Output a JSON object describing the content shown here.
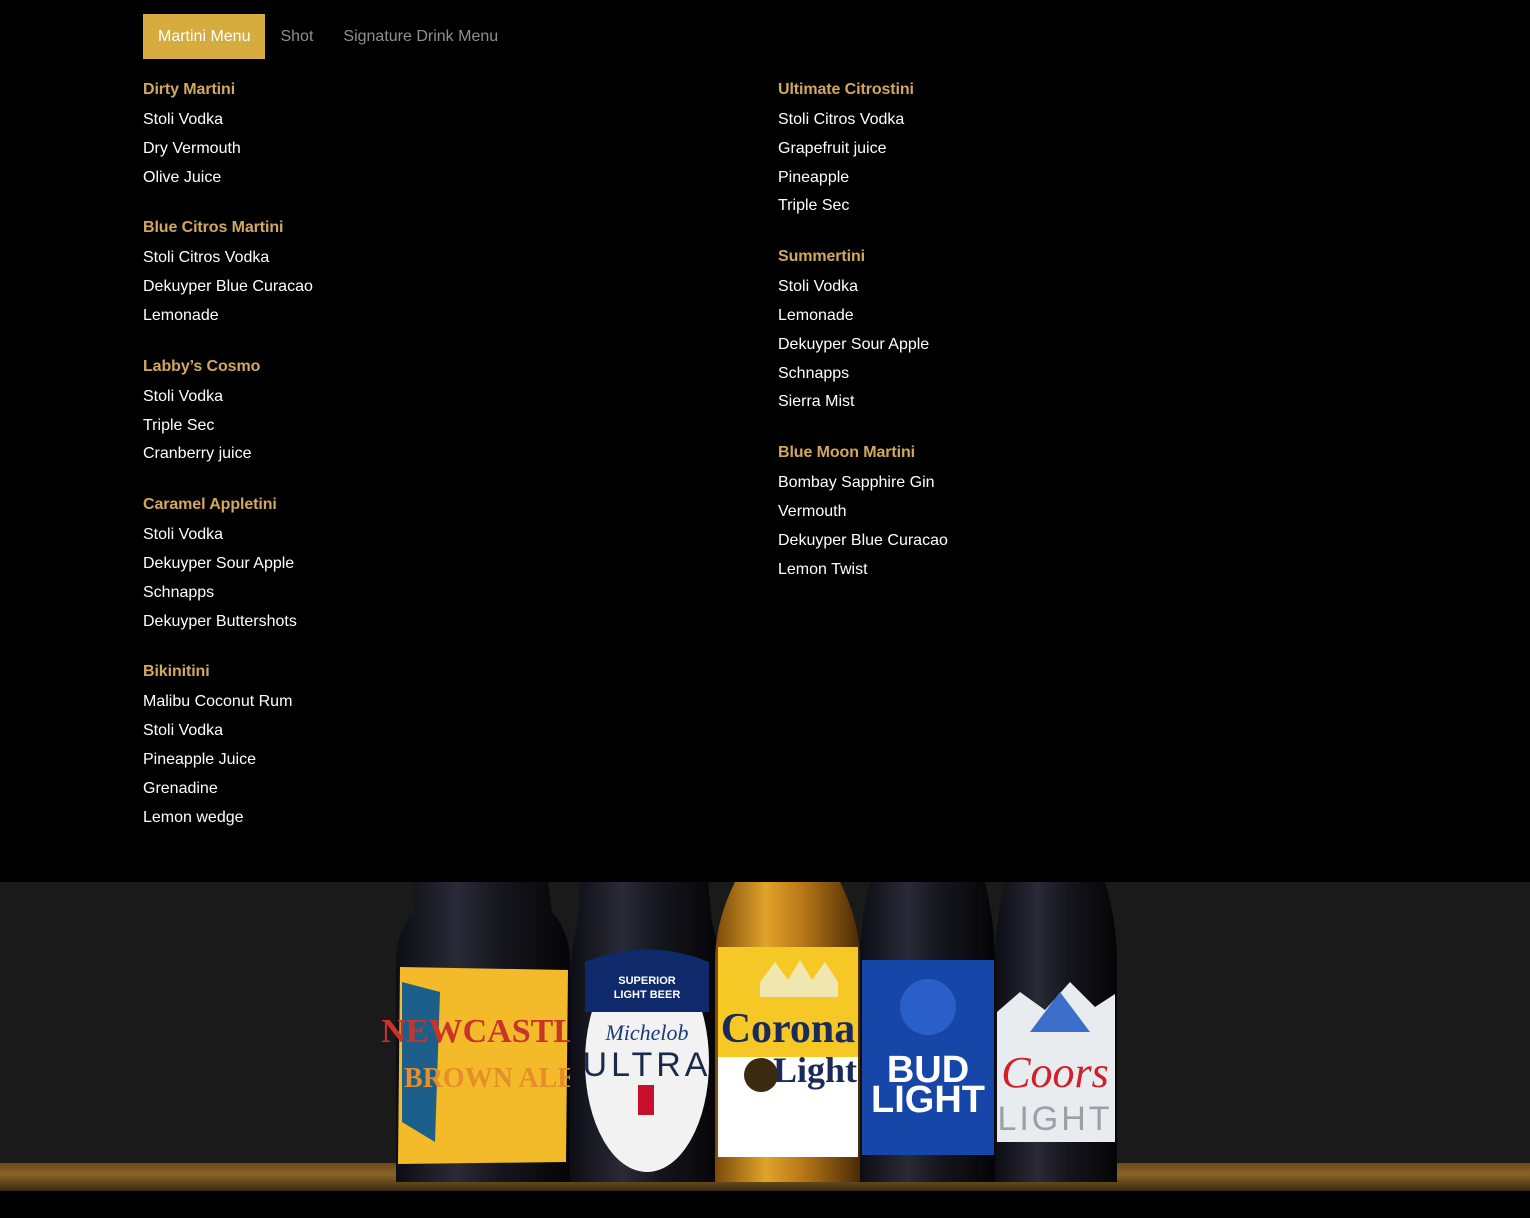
{
  "tabs": [
    {
      "label": "Martini Menu",
      "active": true
    },
    {
      "label": "Shot",
      "active": false
    },
    {
      "label": "Signature Drink Menu",
      "active": false
    }
  ],
  "colors": {
    "accent": "#d6ac3e",
    "drink_title": "#d2a85e",
    "background": "#000000"
  },
  "left_column": [
    {
      "name": "Dirty Martini",
      "ingredients": [
        "Stoli Vodka",
        "Dry Vermouth",
        "Olive Juice"
      ]
    },
    {
      "name": "Blue Citros Martini",
      "ingredients": [
        "Stoli Citros Vodka",
        "Dekuyper Blue Curacao",
        "Lemonade"
      ]
    },
    {
      "name": "Labby’s Cosmo",
      "ingredients": [
        "Stoli Vodka",
        "Triple Sec",
        "Cranberry juice"
      ]
    },
    {
      "name": "Caramel Appletini",
      "ingredients": [
        "Stoli Vodka",
        "Dekuyper Sour Apple",
        "Schnapps",
        "Dekuyper Buttershots"
      ]
    },
    {
      "name": "Bikinitini",
      "ingredients": [
        "Malibu Coconut Rum",
        "Stoli Vodka",
        "Pineapple Juice",
        "Grenadine",
        "Lemon wedge"
      ]
    }
  ],
  "right_column": [
    {
      "name": "Ultimate Citrostini",
      "ingredients": [
        "Stoli Citros Vodka",
        "Grapefruit juice",
        "Pineapple",
        "Triple Sec"
      ]
    },
    {
      "name": "Summertini",
      "ingredients": [
        "Stoli Vodka",
        "Lemonade",
        "Dekuyper Sour Apple",
        "Schnapps",
        "Sierra Mist"
      ]
    },
    {
      "name": "Blue Moon Martini",
      "ingredients": [
        "Bombay Sapphire Gin",
        "Vermouth",
        "Dekuyper Blue Curacao",
        "Lemon Twist"
      ]
    }
  ],
  "bottle_image": {
    "labels": [
      "NEWCASTLE",
      "BROWN ALE",
      "SUPERIOR",
      "LIGHT BEER",
      "Michelob",
      "ULTRA",
      "Corona",
      "Light",
      "BUD",
      "LIGHT",
      "Coors",
      "LIGHT"
    ]
  }
}
